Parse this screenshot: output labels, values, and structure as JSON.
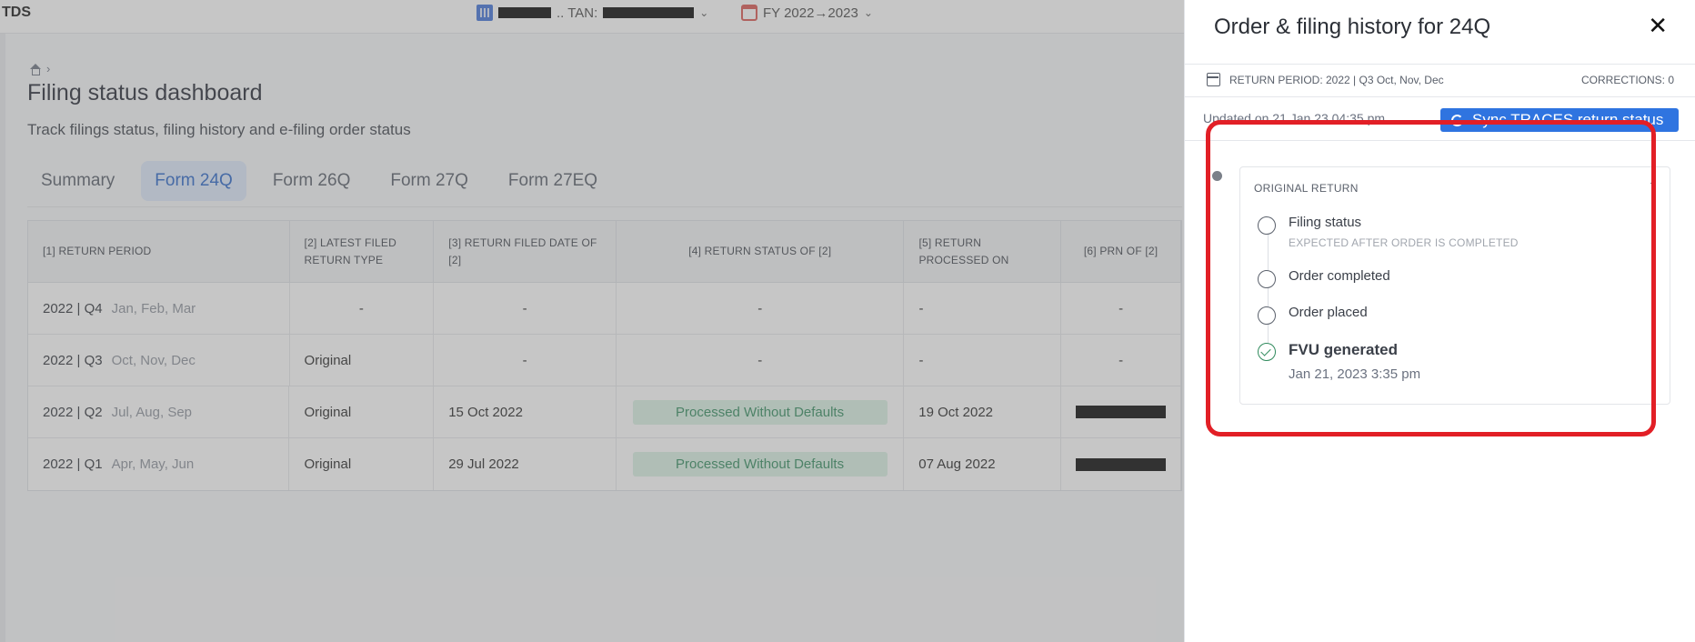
{
  "app": {
    "brand": "TDS",
    "org_suffix": ".. TAN:",
    "fy_label": "FY 2022→2023"
  },
  "page": {
    "title": "Filing status dashboard",
    "subtitle": "Track filings status, filing history and e-filing order status"
  },
  "tabs": [
    {
      "label": "Summary",
      "active": false
    },
    {
      "label": "Form 24Q",
      "active": true
    },
    {
      "label": "Form 26Q",
      "active": false
    },
    {
      "label": "Form 27Q",
      "active": false
    },
    {
      "label": "Form 27EQ",
      "active": false
    }
  ],
  "table": {
    "headers": [
      "[1] RETURN PERIOD",
      "[2] LATEST FILED RETURN TYPE",
      "[3] RETURN FILED DATE OF [2]",
      "[4] RETURN STATUS OF [2]",
      "[5] RETURN PROCESSED ON",
      "[6] PRN OF [2]"
    ],
    "rows": [
      {
        "year": "2022 | Q4",
        "months": "Jan, Feb, Mar",
        "type": "-",
        "filed": "-",
        "status": "-",
        "processed": "-",
        "prn": "-"
      },
      {
        "year": "2022 | Q3",
        "months": "Oct, Nov, Dec",
        "type": "Original",
        "filed": "-",
        "status": "-",
        "processed": "-",
        "prn": "-"
      },
      {
        "year": "2022 | Q2",
        "months": "Jul, Aug, Sep",
        "type": "Original",
        "filed": "15 Oct 2022",
        "status": "Processed Without Defaults",
        "processed": "19 Oct 2022",
        "prn": ""
      },
      {
        "year": "2022 | Q1",
        "months": "Apr, May, Jun",
        "type": "Original",
        "filed": "29 Jul 2022",
        "status": "Processed Without Defaults",
        "processed": "07 Aug 2022",
        "prn": ""
      }
    ]
  },
  "drawer": {
    "title": "Order & filing history for 24Q",
    "close": "✕",
    "return_period": "RETURN PERIOD: 2022 | Q3 Oct, Nov, Dec",
    "corrections": "CORRECTIONS: 0",
    "updated": "Updated on 21 Jan 23 04:35 pm",
    "sync_label": "Sync TRACES return status",
    "card_title": "ORIGINAL RETURN",
    "steps": [
      {
        "label": "Filing status",
        "sub": "EXPECTED AFTER ORDER IS COMPLETED"
      },
      {
        "label": "Order completed"
      },
      {
        "label": "Order placed"
      },
      {
        "label": "FVU generated",
        "time": "Jan 21, 2023 3:35 pm"
      }
    ]
  },
  "colors": {
    "accent": "#2f74e0",
    "active_tab_bg": "#dce8fb",
    "status_pill_bg": "#d9f1e4",
    "status_pill_text": "#2f8a5c",
    "highlight": "#e21f26"
  }
}
